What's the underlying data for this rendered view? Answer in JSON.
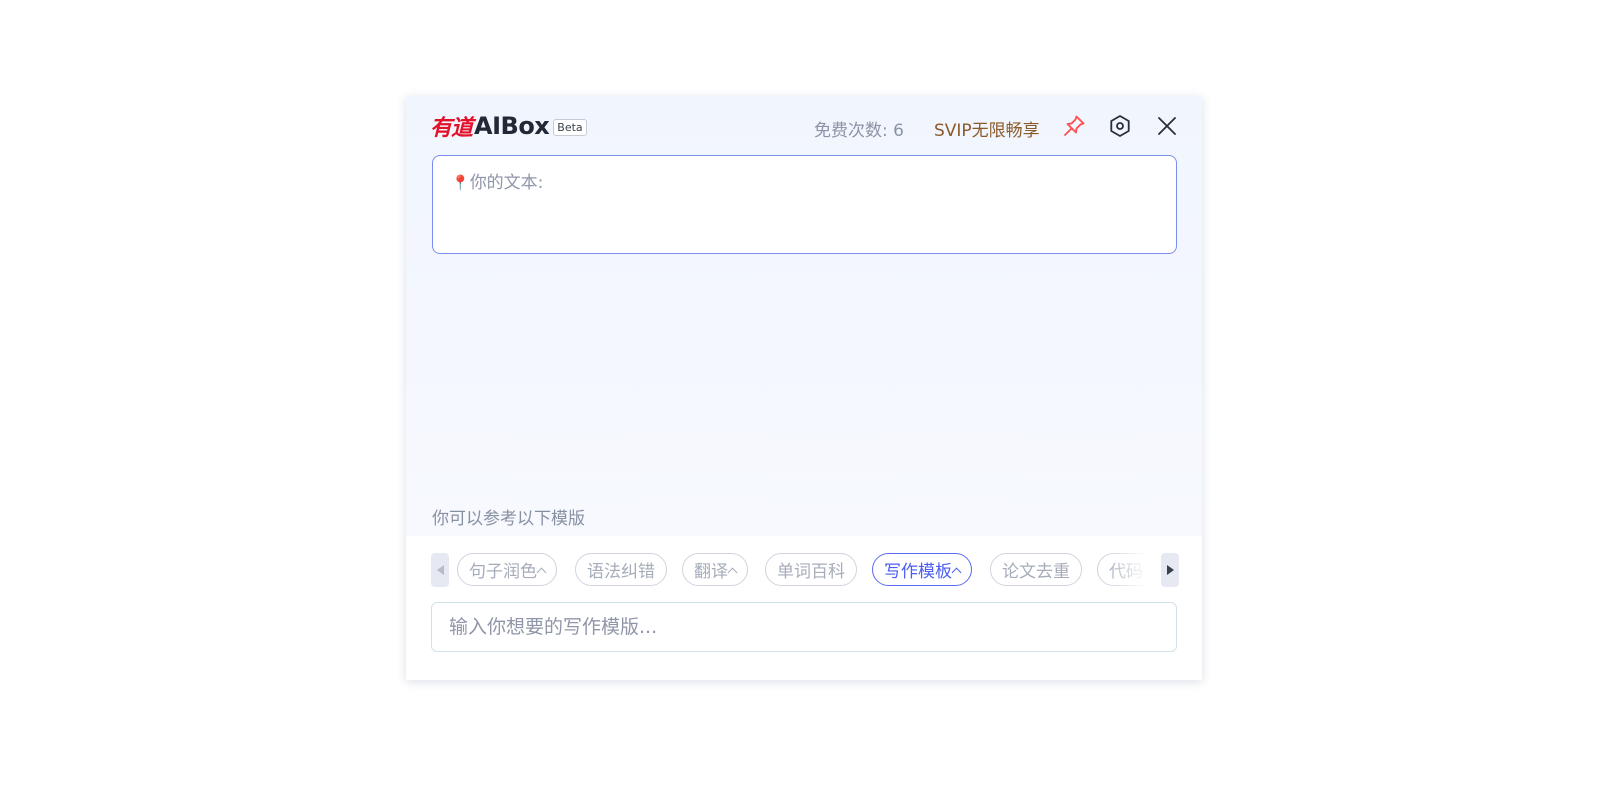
{
  "app": {
    "logo_cn": "有道",
    "logo_en": "AIBox",
    "badge": "Beta"
  },
  "header": {
    "free_count": "免费次数: 6",
    "svip": "SVIP无限畅享",
    "icons": {
      "pin": "pin-icon",
      "settings": "settings-icon",
      "close": "close-icon"
    },
    "colors": {
      "pin": "#ff4d4f",
      "svip": "#8a5a2b"
    }
  },
  "text_box": {
    "pin_glyph": "📍",
    "label": "你的文本:"
  },
  "templates": {
    "hint": "你可以参考以下模版",
    "chips": [
      {
        "label": "句子润色",
        "has_caret": true,
        "active": false
      },
      {
        "label": "语法纠错",
        "has_caret": false,
        "active": false
      },
      {
        "label": "翻译",
        "has_caret": true,
        "active": false
      },
      {
        "label": "单词百科",
        "has_caret": false,
        "active": false
      },
      {
        "label": "写作模板",
        "has_caret": true,
        "active": true
      },
      {
        "label": "论文去重",
        "has_caret": false,
        "active": false
      },
      {
        "label": "代码",
        "has_caret": false,
        "active": false
      }
    ],
    "input_placeholder": "输入你想要的写作模版...",
    "accent": "#4c5ef0"
  }
}
